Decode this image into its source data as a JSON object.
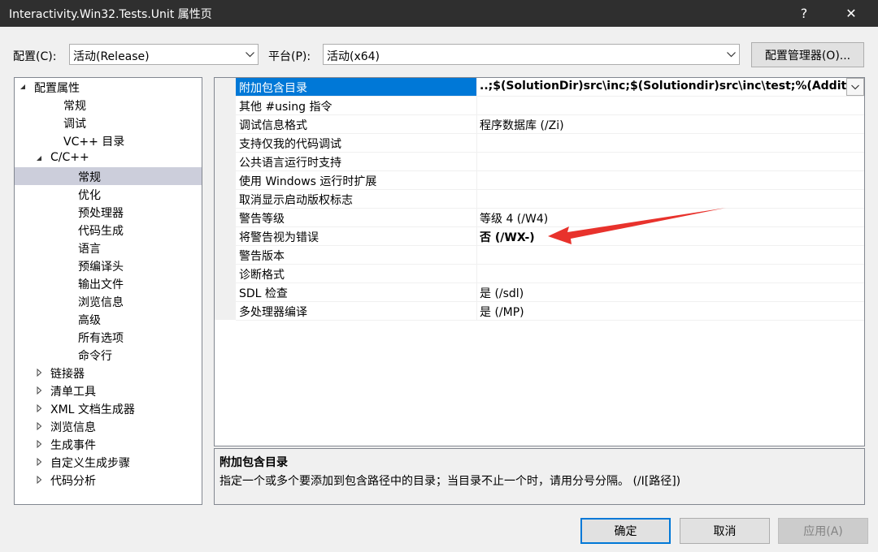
{
  "window": {
    "title": "Interactivity.Win32.Tests.Unit 属性页",
    "help_glyph": "?",
    "close_glyph": "✕"
  },
  "toolbar": {
    "config_label": "配置(C):",
    "config_value": "活动(Release)",
    "platform_label": "平台(P):",
    "platform_value": "活动(x64)",
    "config_manager_label": "配置管理器(O)..."
  },
  "tree": {
    "items": [
      {
        "label": "配置属性",
        "expander": "expanded"
      },
      {
        "label": "常规",
        "expander": "none"
      },
      {
        "label": "调试",
        "expander": "none"
      },
      {
        "label": "VC++ 目录",
        "expander": "none"
      },
      {
        "label": "C/C++",
        "expander": "expanded"
      },
      {
        "label": "常规",
        "expander": "none",
        "selected": true
      },
      {
        "label": "优化",
        "expander": "none"
      },
      {
        "label": "预处理器",
        "expander": "none"
      },
      {
        "label": "代码生成",
        "expander": "none"
      },
      {
        "label": "语言",
        "expander": "none"
      },
      {
        "label": "预编译头",
        "expander": "none"
      },
      {
        "label": "输出文件",
        "expander": "none"
      },
      {
        "label": "浏览信息",
        "expander": "none"
      },
      {
        "label": "高级",
        "expander": "none"
      },
      {
        "label": "所有选项",
        "expander": "none"
      },
      {
        "label": "命令行",
        "expander": "none"
      },
      {
        "label": "链接器",
        "expander": "collapsed"
      },
      {
        "label": "清单工具",
        "expander": "collapsed"
      },
      {
        "label": "XML 文档生成器",
        "expander": "collapsed"
      },
      {
        "label": "浏览信息",
        "expander": "collapsed"
      },
      {
        "label": "生成事件",
        "expander": "collapsed"
      },
      {
        "label": "自定义生成步骤",
        "expander": "collapsed"
      },
      {
        "label": "代码分析",
        "expander": "collapsed"
      }
    ]
  },
  "properties": {
    "rows": [
      {
        "name": "附加包含目录",
        "value": "..;$(SolutionDir)src\\inc;$(Solutiondir)src\\inc\\test;%(AdditionalIncludeDirectories)",
        "selected": true,
        "bold": true
      },
      {
        "name": "其他 #using 指令",
        "value": ""
      },
      {
        "name": "调试信息格式",
        "value": "程序数据库 (/Zi)"
      },
      {
        "name": "支持仅我的代码调试",
        "value": ""
      },
      {
        "name": "公共语言运行时支持",
        "value": ""
      },
      {
        "name": "使用 Windows 运行时扩展",
        "value": ""
      },
      {
        "name": "取消显示启动版权标志",
        "value": ""
      },
      {
        "name": "警告等级",
        "value": "等级 4 (/W4)"
      },
      {
        "name": "将警告视为错误",
        "value": "否 (/WX-)",
        "bold": true
      },
      {
        "name": "警告版本",
        "value": ""
      },
      {
        "name": "诊断格式",
        "value": ""
      },
      {
        "name": "SDL 检查",
        "value": "是 (/sdl)"
      },
      {
        "name": "多处理器编译",
        "value": "是 (/MP)"
      }
    ]
  },
  "description": {
    "title": "附加包含目录",
    "text": "指定一个或多个要添加到包含路径中的目录；当目录不止一个时，请用分号分隔。     (/I[路径])"
  },
  "footer": {
    "ok_label": "确定",
    "cancel_label": "取消",
    "apply_label": "应用(A)"
  },
  "colors": {
    "selection_blue": "#0078d7",
    "annotation_red": "#e8322c",
    "tree_selection": "#cccedb",
    "title_bar": "#2f2f2f"
  }
}
